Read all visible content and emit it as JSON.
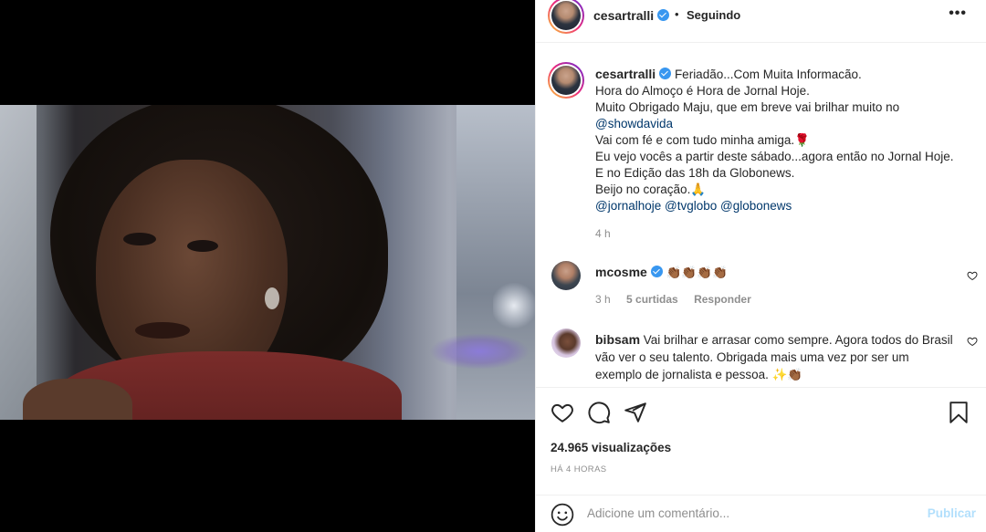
{
  "header": {
    "username": "cesartralli",
    "separator": "•",
    "follow_status": "Seguindo",
    "more": "•••"
  },
  "caption": {
    "username": "cesartralli",
    "lines": [
      "Feriadão...Com Muita Informacão.",
      "Hora do Almoço é Hora de Jornal Hoje.",
      "Muito Obrigado Maju, que em breve vai brilhar muito no",
      "@showdavida",
      "Vai com fé e com tudo minha amiga.🌹",
      "Eu vejo vocês a partir deste sábado...agora então no Jornal Hoje.",
      "E no Edição das 18h da Globonews.",
      "Beijo no coração.🙏"
    ],
    "tags": [
      "@jornalhoje",
      "@tvglobo",
      "@globonews"
    ],
    "time": "4 h"
  },
  "comments": [
    {
      "username": "mcosme",
      "text": "👏🏾👏🏾👏🏾👏🏾",
      "time": "3 h",
      "likes": "5 curtidas",
      "reply": "Responder"
    },
    {
      "username": "bibsam",
      "text": "Vai brilhar e arrasar como sempre. Agora todos do Brasil vão ver o seu talento. Obrigada mais uma vez por ser um exemplo de jornalista e pessoa. ✨👏🏾"
    }
  ],
  "stats": {
    "views": "24.965 visualizações",
    "ago": "HÁ 4 HORAS"
  },
  "add_comment": {
    "placeholder": "Adicione um comentário...",
    "publish": "Publicar"
  },
  "icons": {
    "verified": "verified-badge-icon",
    "like": "heart-icon",
    "comment": "comment-icon",
    "share": "share-icon",
    "save": "bookmark-icon",
    "emoji": "smiley-icon"
  },
  "colors": {
    "link": "#00376b",
    "verified": "#3897f0",
    "muted": "#8e8e8e",
    "publish_disabled": "#b2dffc"
  }
}
